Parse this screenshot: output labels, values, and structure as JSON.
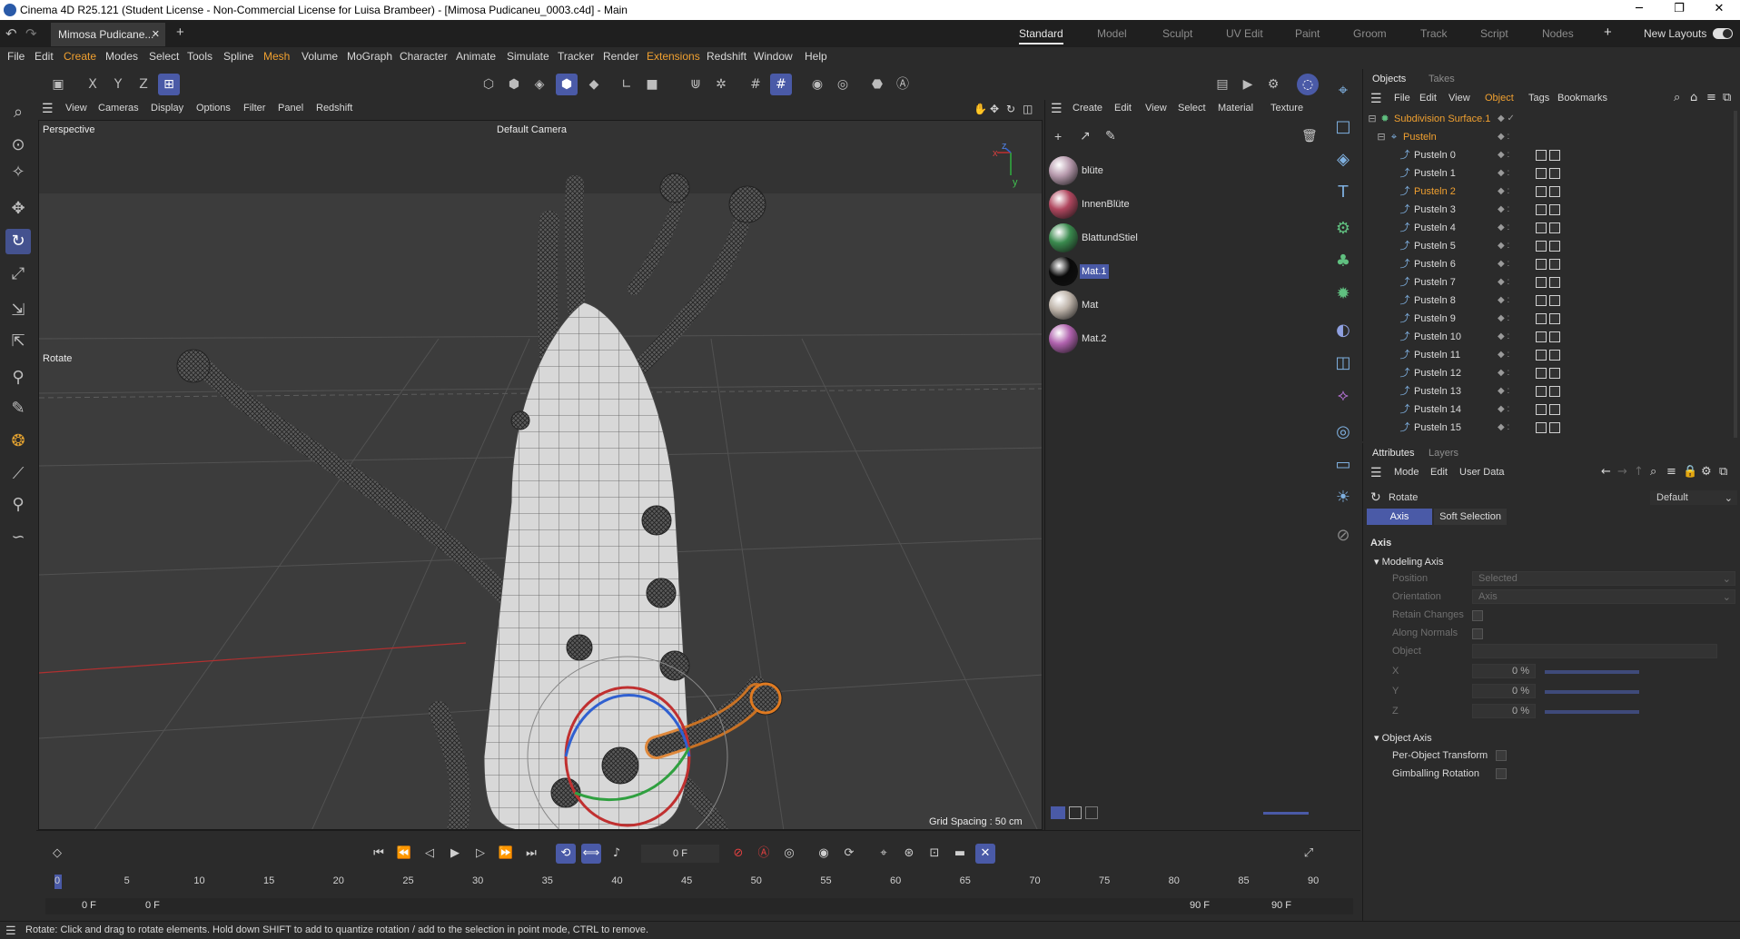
{
  "window": {
    "title": "Cinema 4D R25.121 (Student License - Non-Commercial License for Luisa Brambeer) - [Mimosa Pudicaneu_0003.c4d] - Main",
    "controls": [
      "─",
      "❐",
      "✕"
    ]
  },
  "doc_tab": {
    "label": "Mimosa Pudicane...",
    "close": "✕",
    "add": "+"
  },
  "layouts": {
    "tabs": [
      "Standard",
      "Model",
      "Sculpt",
      "UV Edit",
      "Paint",
      "Groom",
      "Track",
      "Script",
      "Nodes"
    ],
    "active": "Standard",
    "add": "+",
    "new_layouts": "New Layouts"
  },
  "menu": [
    "File",
    "Edit",
    "Create",
    "Modes",
    "Select",
    "Tools",
    "Spline",
    "Mesh",
    "Volume",
    "MoGraph",
    "Character",
    "Animate",
    "Simulate",
    "Tracker",
    "Render",
    "Extensions",
    "Redshift",
    "Window",
    "Help"
  ],
  "toolbar": {
    "axis_x": "X",
    "axis_y": "Y",
    "axis_z": "Z"
  },
  "viewport": {
    "menu": [
      "View",
      "Cameras",
      "Display",
      "Options",
      "Filter",
      "Panel",
      "Redshift"
    ],
    "label": "Perspective",
    "camera": "Default Camera",
    "tool_label": "Rotate",
    "grid_spacing": "Grid Spacing : 50 cm",
    "axis_x": "x",
    "axis_y": "y",
    "axis_z": "z"
  },
  "materials": {
    "menu": [
      "Create",
      "Edit",
      "View",
      "Select",
      "Material",
      "Texture"
    ],
    "items": [
      {
        "name": "blüte",
        "color": "#b79aad"
      },
      {
        "name": "InnenBlüte",
        "color": "#b0475f"
      },
      {
        "name": "BlattundStiel",
        "color": "#3a8a4e"
      },
      {
        "name": "Mat.1",
        "color": "#0a0a0a"
      },
      {
        "name": "Mat",
        "color": "#bdb3a9"
      },
      {
        "name": "Mat.2",
        "color": "#b062ae"
      }
    ],
    "selected": "Mat.1"
  },
  "objects": {
    "tabs": [
      "Objects",
      "Takes"
    ],
    "menu": [
      "File",
      "Edit",
      "View",
      "Object",
      "Tags",
      "Bookmarks"
    ],
    "root": "Subdivision Surface.1",
    "group": "Pusteln",
    "children": [
      "Pusteln 0",
      "Pusteln 1",
      "Pusteln 2",
      "Pusteln 3",
      "Pusteln 4",
      "Pusteln 5",
      "Pusteln 6",
      "Pusteln 7",
      "Pusteln 8",
      "Pusteln 9",
      "Pusteln 10",
      "Pusteln 11",
      "Pusteln 12",
      "Pusteln 13",
      "Pusteln 14",
      "Pusteln 15"
    ],
    "highlighted": "Pusteln 2"
  },
  "attributes": {
    "tabs": [
      "Attributes",
      "Layers"
    ],
    "menu": [
      "Mode",
      "Edit",
      "User Data"
    ],
    "tool": "Rotate",
    "preset": "Default",
    "subtabs": [
      "Axis",
      "Soft Selection"
    ],
    "section": "Axis",
    "modeling_axis": "Modeling Axis",
    "position_label": "Position",
    "position_value": "Selected",
    "orientation_label": "Orientation",
    "orientation_value": "Axis",
    "retain_changes": "Retain Changes",
    "along_normals": "Along Normals",
    "object_label": "Object",
    "x_label": "X",
    "x_value": "0 %",
    "y_label": "Y",
    "y_value": "0 %",
    "z_label": "Z",
    "z_value": "0 %",
    "object_axis": "Object Axis",
    "per_object": "Per-Object Transform",
    "gimballing": "Gimballing Rotation"
  },
  "timeline": {
    "current_frame": "0 F",
    "ticks": [
      "0",
      "5",
      "10",
      "15",
      "20",
      "25",
      "30",
      "35",
      "40",
      "45",
      "50",
      "55",
      "60",
      "65",
      "70",
      "75",
      "80",
      "85",
      "90"
    ],
    "start": "0 F",
    "start2": "0 F",
    "end": "90 F",
    "end2": "90 F"
  },
  "status": "Rotate: Click and drag to rotate elements. Hold down SHIFT to add to quantize rotation / add to the selection in point mode, CTRL to remove."
}
